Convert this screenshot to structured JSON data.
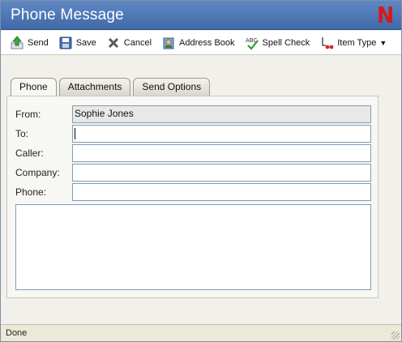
{
  "window": {
    "title": "Phone Message",
    "brand_letter": "N"
  },
  "toolbar": {
    "send": "Send",
    "save": "Save",
    "cancel": "Cancel",
    "address_book": "Address Book",
    "spell_check": "Spell Check",
    "item_type": "Item Type"
  },
  "tabs": [
    "Phone",
    "Attachments",
    "Send Options"
  ],
  "form": {
    "from_label": "From:",
    "from_value": "Sophie Jones",
    "to_label": "To:",
    "to_value": "",
    "caller_label": "Caller:",
    "caller_value": "",
    "company_label": "Company:",
    "company_value": "",
    "phone_label": "Phone:",
    "phone_value": "",
    "message": ""
  },
  "status": {
    "text": "Done"
  },
  "colors": {
    "titlebar": "#4d78b6",
    "brand": "#d81818",
    "field_border": "#7f9db9"
  },
  "icons": [
    "send-icon",
    "save-icon",
    "cancel-icon",
    "address-book-icon",
    "spell-check-icon",
    "item-type-icon",
    "chevron-down-icon"
  ]
}
